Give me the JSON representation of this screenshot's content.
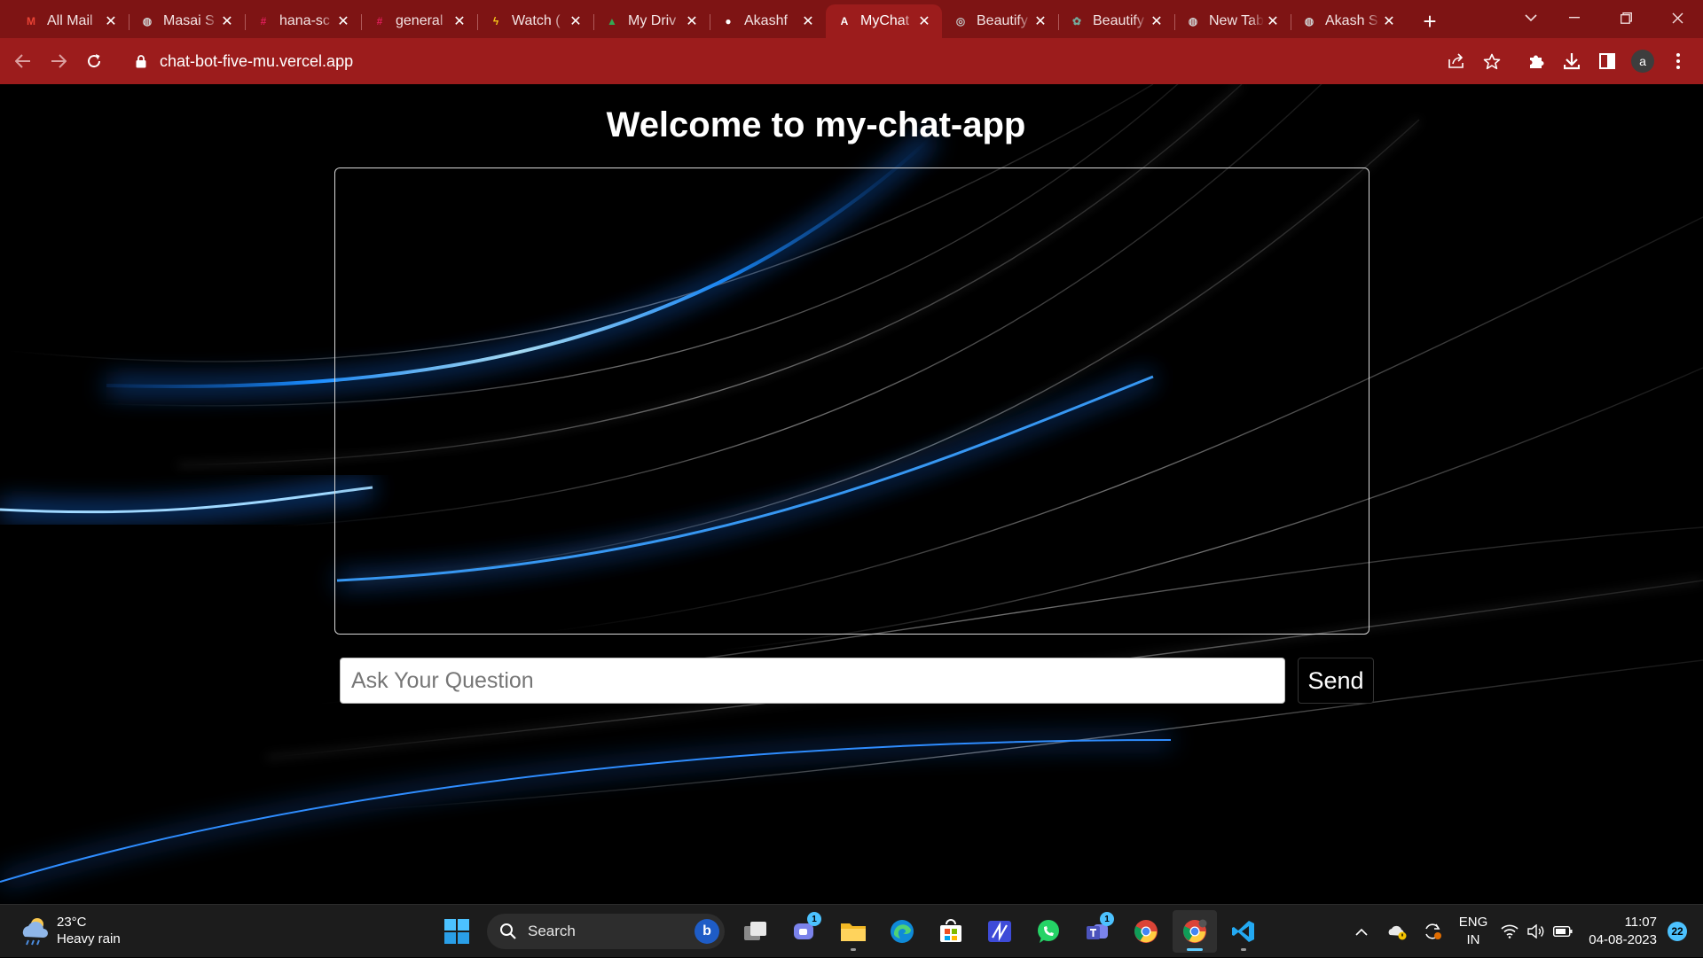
{
  "browser": {
    "tabs": [
      {
        "title": "All Mail",
        "icon": "gmail-icon",
        "color": "#ea4335"
      },
      {
        "title": "Masai S",
        "icon": "globe-icon",
        "color": "#cfcfcf"
      },
      {
        "title": "hana-sc",
        "icon": "slack-icon",
        "color": "#e01e5a"
      },
      {
        "title": "general",
        "icon": "slack-icon",
        "color": "#e01e5a"
      },
      {
        "title": "Watch (",
        "icon": "pikachu-icon",
        "color": "#f5c518"
      },
      {
        "title": "My Driv",
        "icon": "google-drive-icon",
        "color": "#34a853"
      },
      {
        "title": "Akashf",
        "icon": "github-icon",
        "color": "#ffffff"
      },
      {
        "title": "MyChat",
        "icon": "a-letter-icon",
        "color": "#ffffff",
        "active": true
      },
      {
        "title": "Beautify",
        "icon": "beautify-icon",
        "color": "#c0c0c0"
      },
      {
        "title": "Beautify",
        "icon": "chatgpt-icon",
        "color": "#74aa9c"
      },
      {
        "title": "New Tab",
        "icon": "globe-icon",
        "color": "#cfcfcf"
      },
      {
        "title": "Akash S",
        "icon": "globe-icon",
        "color": "#cfcfcf"
      }
    ],
    "url": "chat-bot-five-mu.vercel.app",
    "profile_initial": "a",
    "theme_color": "#9c1c1c"
  },
  "app": {
    "title": "Welcome to my-chat-app",
    "input_placeholder": "Ask Your Question",
    "input_value": "",
    "send_label": "Send"
  },
  "taskbar": {
    "weather_temp": "23°C",
    "weather_desc": "Heavy rain",
    "search_label": "Search",
    "apps": [
      {
        "name": "start-icon"
      },
      {
        "name": "search"
      },
      {
        "name": "task-view-icon"
      },
      {
        "name": "teams-chat-icon",
        "badge": "1"
      },
      {
        "name": "file-explorer-icon",
        "open": true
      },
      {
        "name": "edge-icon"
      },
      {
        "name": "microsoft-store-icon"
      },
      {
        "name": "pen-app-icon"
      },
      {
        "name": "whatsapp-icon"
      },
      {
        "name": "teams-icon",
        "badge": "1"
      },
      {
        "name": "chrome-icon"
      },
      {
        "name": "chrome-profile-icon",
        "open": true,
        "active": true
      },
      {
        "name": "vscode-icon",
        "open": true
      }
    ],
    "lang_line1": "ENG",
    "lang_line2": "IN",
    "time": "11:07",
    "date": "04-08-2023",
    "notifications": "22"
  }
}
